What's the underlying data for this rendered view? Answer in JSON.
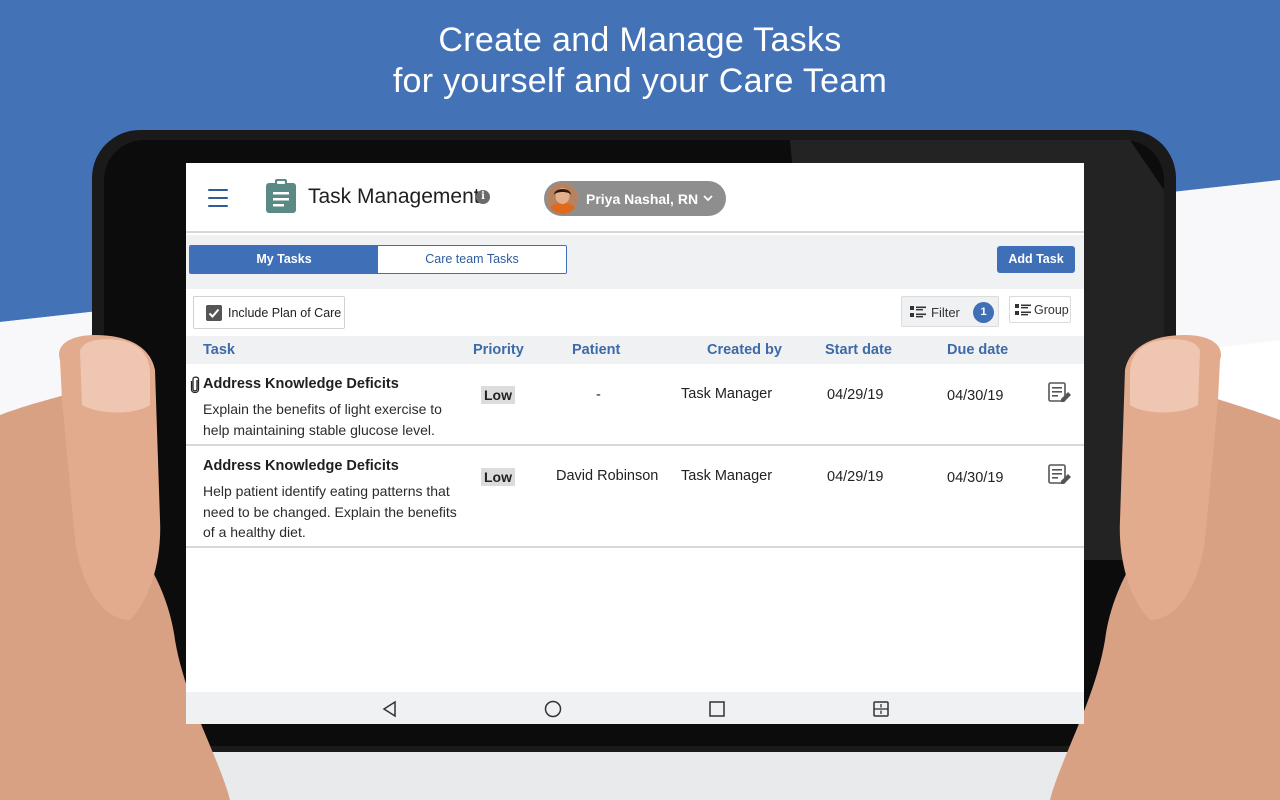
{
  "headline": {
    "line1": "Create and Manage Tasks",
    "line2": "for yourself and your Care Team"
  },
  "colors": {
    "brand_blue": "#4472b7",
    "accent": "#3f6fb6",
    "header_text": "#3d6aa8",
    "toolbar_gray": "#f0f1f3"
  },
  "app": {
    "title": "Task Management",
    "menu_icon": "hamburger-icon",
    "app_icon": "clipboard-icon",
    "info_icon": "info-icon"
  },
  "user": {
    "name": "Priya Nashal, RN",
    "dropdown_icon": "chevron-down-icon"
  },
  "tabs": [
    {
      "label": "My Tasks",
      "active": true
    },
    {
      "label": "Care team Tasks",
      "active": false
    }
  ],
  "toolbar": {
    "add_task_label": "Add Task",
    "include_plan_label": "Include Plan of Care",
    "include_plan_checked": true,
    "filter_label": "Filter",
    "filter_count": "1",
    "group_label": "Group"
  },
  "table": {
    "columns": [
      "Task",
      "Priority",
      "Patient",
      "Created by",
      "Start date",
      "Due date"
    ],
    "rows": [
      {
        "has_attachment": true,
        "task": "Address Knowledge Deficits",
        "description": "Explain the benefits of light exercise to help maintaining stable glucose level.",
        "priority": "Low",
        "patient": "-",
        "created_by": "Task Manager",
        "start_date": "04/29/19",
        "due_date": "04/30/19",
        "action_icon": "edit-note-icon"
      },
      {
        "has_attachment": false,
        "task": "Address Knowledge Deficits",
        "description": "Help patient identify eating patterns that need to be changed. Explain the benefits of a healthy diet.",
        "priority": "Low",
        "patient": "David Robinson",
        "created_by": "Task Manager",
        "start_date": "04/29/19",
        "due_date": "04/30/19",
        "action_icon": "edit-note-icon"
      }
    ]
  },
  "system_nav": [
    "back-icon",
    "home-icon",
    "recents-icon",
    "split-screen-icon"
  ]
}
